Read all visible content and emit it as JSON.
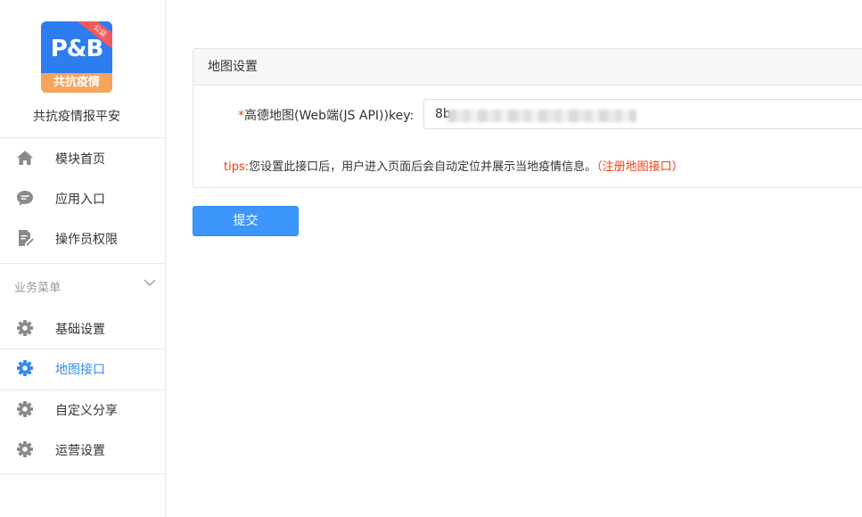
{
  "sidebar": {
    "logo": {
      "brand_text": "P&B",
      "band_text": "共抗疫情",
      "ribbon_text": "公益"
    },
    "app_name": "共抗疫情报平安",
    "top_items": [
      {
        "label": "模块首页",
        "icon": "home-icon"
      },
      {
        "label": "应用入口",
        "icon": "chat-icon"
      },
      {
        "label": "操作员权限",
        "icon": "edit-doc-icon"
      }
    ],
    "section_title": "业务菜单",
    "section_items": [
      {
        "label": "基础设置",
        "icon": "gear-icon",
        "active": false
      },
      {
        "label": "地图接口",
        "icon": "gear-icon",
        "active": true
      },
      {
        "label": "自定义分享",
        "icon": "gear-icon",
        "active": false
      },
      {
        "label": "运营设置",
        "icon": "gear-icon",
        "active": false
      }
    ]
  },
  "main": {
    "panel_title": "地图设置",
    "field": {
      "required_mark": "*",
      "label": "高德地图(Web端(JS API))key:",
      "value": "8b"
    },
    "tips": {
      "prefix": "tips:",
      "text": "您设置此接口后，用户进入页面后会自动定位并展示当地疫情信息。",
      "link": "（注册地图接口）"
    },
    "submit_label": "提交"
  },
  "colors": {
    "accent": "#2d8cf0",
    "danger": "#ed3f14",
    "button": "#3d96fb"
  }
}
